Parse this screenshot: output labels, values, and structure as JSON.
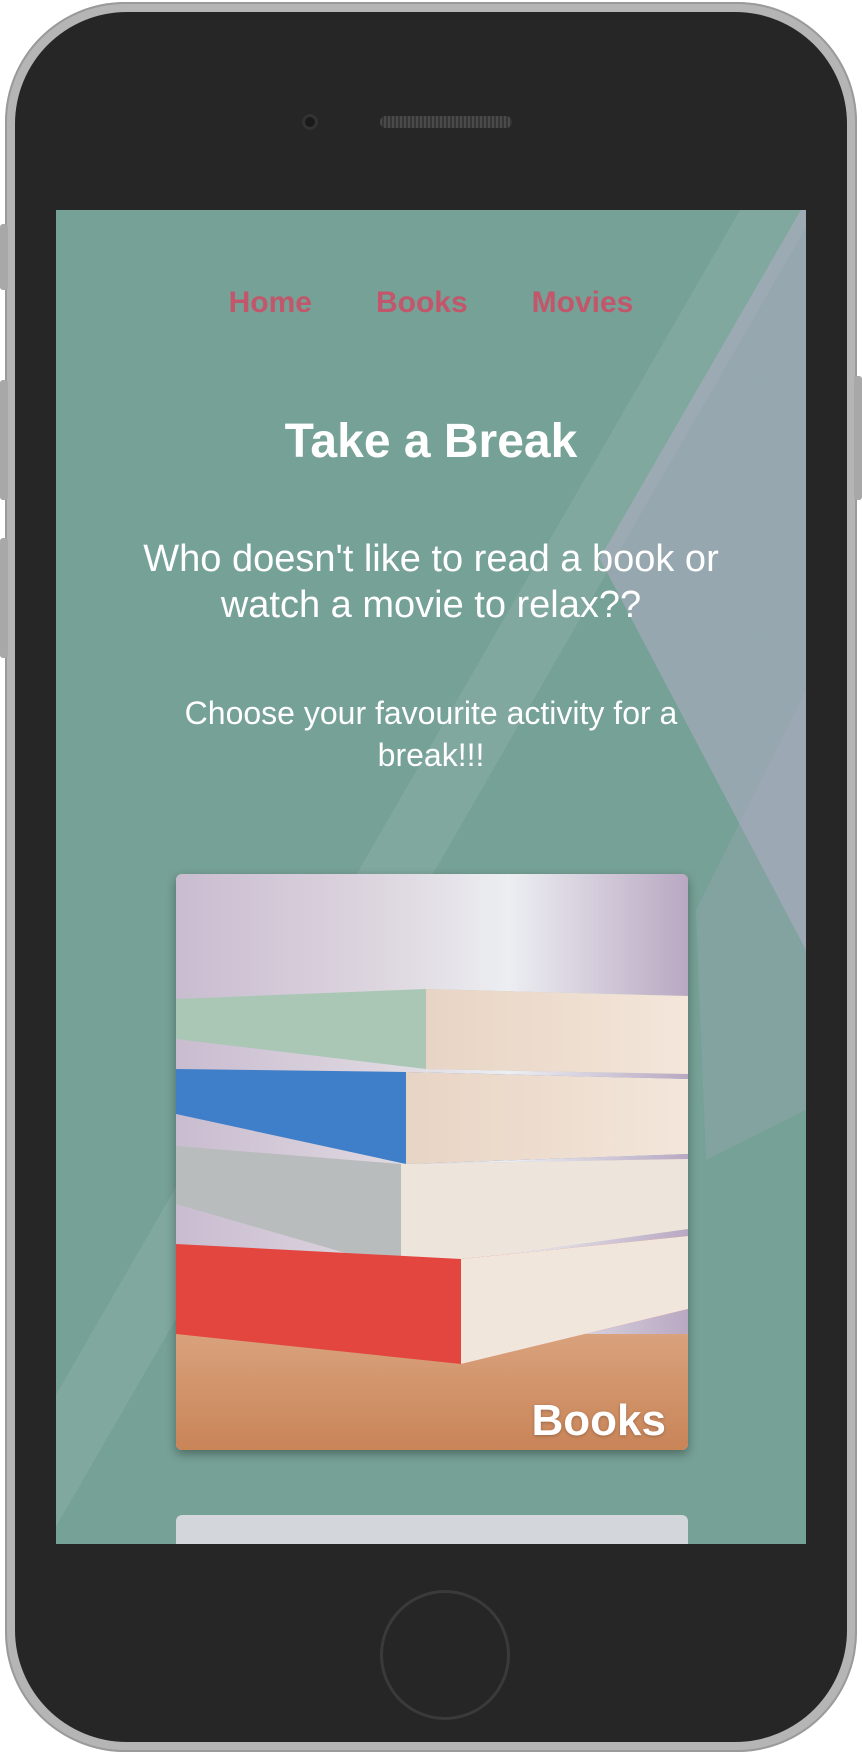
{
  "nav": {
    "items": [
      {
        "label": "Home"
      },
      {
        "label": "Books"
      },
      {
        "label": "Movies"
      }
    ]
  },
  "hero": {
    "title": "Take a Break",
    "lead": "Who doesn't like to read a book or watch a movie to relax??",
    "sub": "Choose your favourite activity for a break!!!"
  },
  "cards": [
    {
      "label": "Books",
      "image": "stack-of-books-photo"
    },
    {
      "label": "",
      "image": "partially-visible-card"
    }
  ],
  "colors": {
    "background": "#76a196",
    "nav_link": "#c2566b",
    "text": "#ffffff",
    "phone_body": "#262626"
  }
}
